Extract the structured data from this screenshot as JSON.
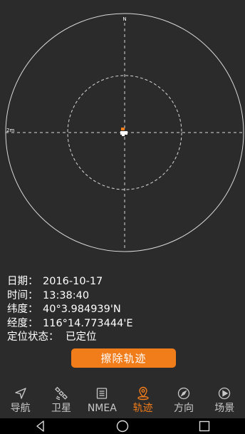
{
  "radar": {
    "north_label": "N",
    "scale_label": "2m"
  },
  "info": {
    "date_label": "日期：",
    "date_value": "2016-10-17",
    "time_label": "时间：",
    "time_value": "13:38:40",
    "lat_label": "纬度：",
    "lat_value": "40°3.984939'N",
    "lon_label": "经度：",
    "lon_value": "116°14.773444'E",
    "status_label": "定位状态：",
    "status_value": "已定位"
  },
  "clear_button": "擦除轨迹",
  "tabs": [
    {
      "label": "导航",
      "icon": "navigation-arrow-icon",
      "active": false
    },
    {
      "label": "卫星",
      "icon": "satellite-icon",
      "active": false
    },
    {
      "label": "NMEA",
      "icon": "document-icon",
      "active": false
    },
    {
      "label": "轨迹",
      "icon": "location-pin-icon",
      "active": true
    },
    {
      "label": "方向",
      "icon": "compass-icon",
      "active": false
    },
    {
      "label": "场景",
      "icon": "play-circle-icon",
      "active": false
    }
  ],
  "colors": {
    "accent": "#f07c1a",
    "background": "#2b2b2b"
  }
}
